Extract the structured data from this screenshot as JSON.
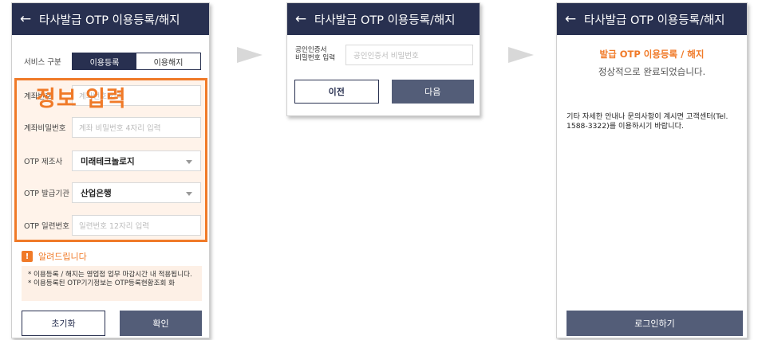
{
  "screen1": {
    "back_glyph": "←",
    "title": "타사발급 OTP 이용등록/해지",
    "service_label": "서비스 구분",
    "seg_register": "이용등록",
    "seg_cancel": "이용해지",
    "account_label": "계좌번호",
    "account_placeholder": "계좌번호 입력",
    "password_label": "계좌비밀번호",
    "password_placeholder": "계좌 비밀번호 4자리 입력",
    "maker_label": "OTP 제조사",
    "maker_value": "미래테크놀로지",
    "issuer_label": "OTP 발급기관",
    "issuer_value": "산업은행",
    "serial_label": "OTP 일련번호",
    "serial_placeholder": "일련번호 12자리 입력",
    "overlay_text": "정보 입력",
    "notice_title": "알려드립니다",
    "notice_icon": "!",
    "notice_line1": "* 이용등록 / 해지는 영업점 업무 마감시간 내 적용됩니다.",
    "notice_line2": "* 이용등록된 OTP기기정보는 OTP등록현황조회 화",
    "reset_button": "초기화",
    "confirm_button": "확인"
  },
  "screen2": {
    "back_glyph": "←",
    "title": "타사발급 OTP 이용등록/해지",
    "cert_label_line1": "공인인증서",
    "cert_label_line2": "비밀번호 입력",
    "cert_placeholder": "공인인증서 비밀번호",
    "prev_button": "이전",
    "next_button": "다음"
  },
  "screen3": {
    "back_glyph": "←",
    "title": "타사발급 OTP 이용등록/해지",
    "done_title": "발급 OTP 이용등록 / 해지",
    "done_subtitle": "정상적으로 완료되었습니다.",
    "info_text": "기타 자세한 안내나 문의사항이 계시면 고객센터(Tel. 1588-3322)를 이용하시기 바랍니다.",
    "login_button": "로그인하기"
  },
  "colors": {
    "header": "#283050",
    "accent": "#f07a28",
    "button_dark": "#535d78"
  }
}
